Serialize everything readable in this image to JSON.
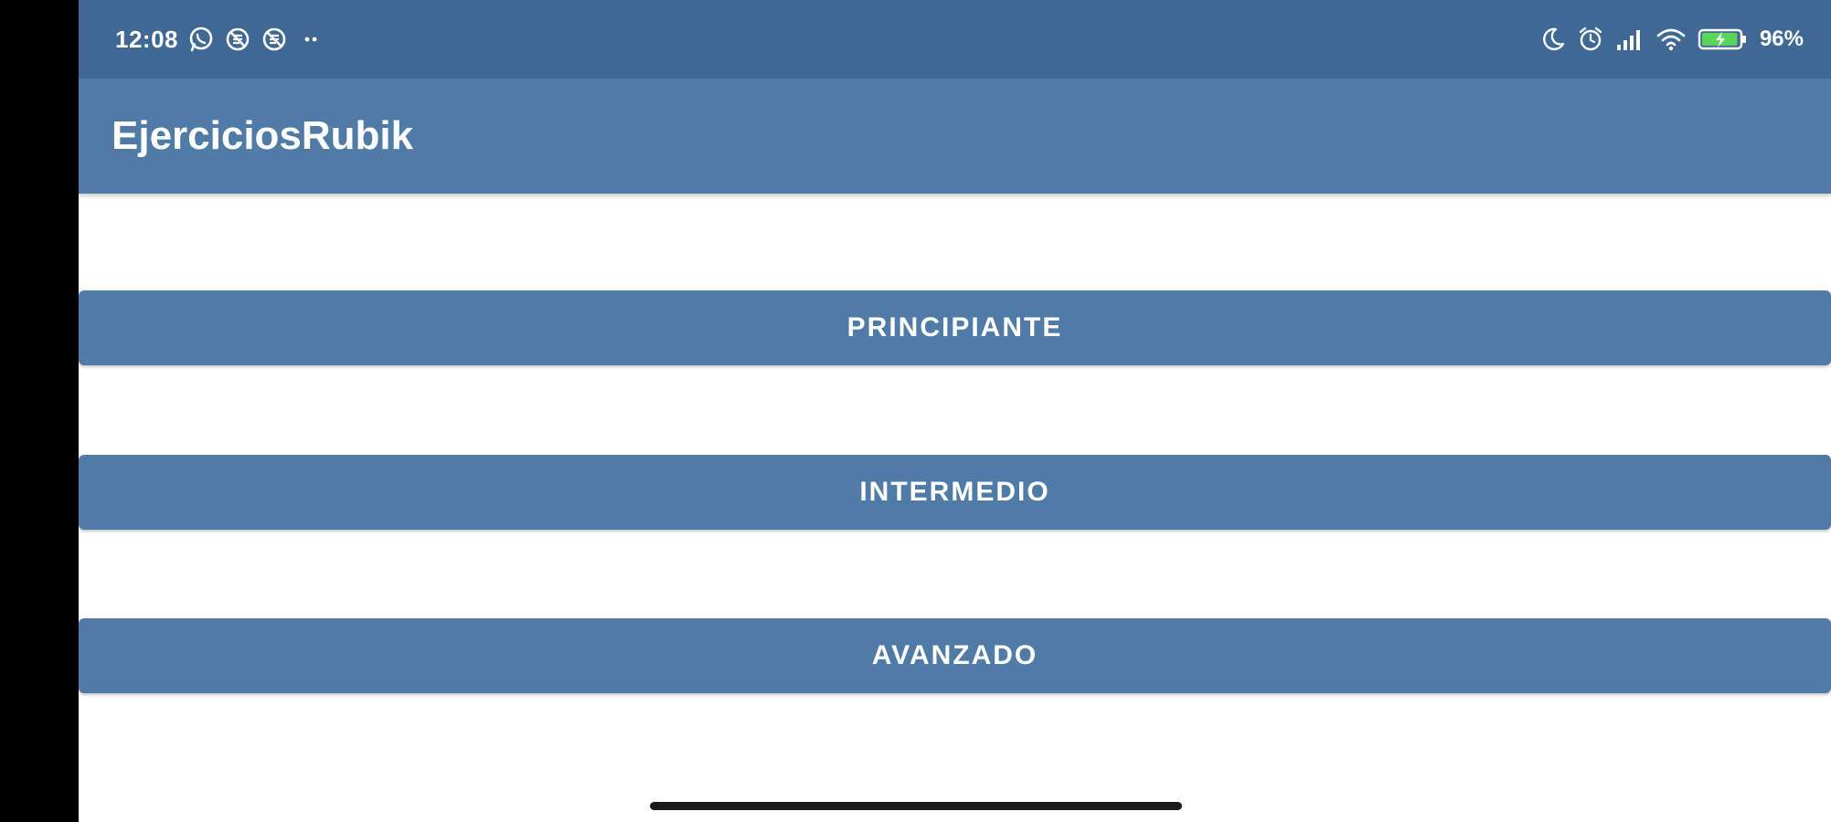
{
  "status_bar": {
    "time": "12:08",
    "left_icons": [
      "whatsapp-icon",
      "no-sync-icon",
      "no-sync-icon",
      "more-dots-icon"
    ],
    "right_icons": [
      "moon-icon",
      "alarm-icon",
      "signal-icon",
      "wifi-icon",
      "battery-charging-icon"
    ],
    "battery_percent": "96",
    "battery_text": "96%"
  },
  "app_bar": {
    "title": "EjerciciosRubik"
  },
  "buttons": [
    {
      "label": "PRINCIPIANTE"
    },
    {
      "label": "INTERMEDIO"
    },
    {
      "label": "AVANZADO"
    }
  ],
  "colors": {
    "status_bar": "#3f6994",
    "primary": "#4f7ba6",
    "background": "#ffffff",
    "text_on_primary": "#ffffff",
    "battery_fill": "#5bd45b"
  }
}
